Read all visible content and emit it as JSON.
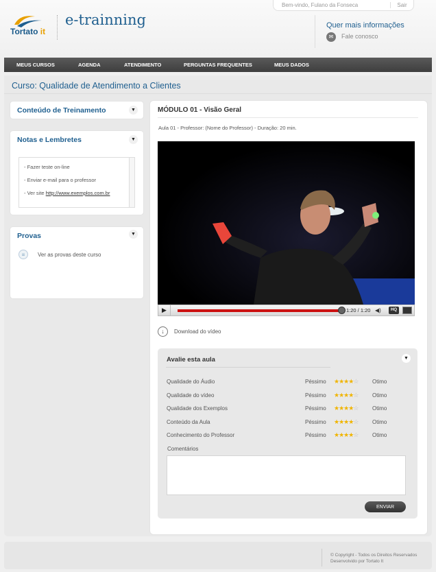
{
  "header": {
    "welcome": "Bem-vindo, Fulano da Fonseca",
    "exit": "Sair",
    "logo_text": "Tortato",
    "logo_suffix": "it",
    "brand": "e-trainning",
    "info_title": "Quer mais informações",
    "contact_label": "Fale conosco"
  },
  "nav": {
    "items": [
      "MEUS CURSOS",
      "AGENDA",
      "ATENDIMENTO",
      "PERGUNTAS FREQUENTES",
      "MEUS DADOS"
    ]
  },
  "course": {
    "title": "Curso: Qualidade de Atendimento a Clientes"
  },
  "sidebar": {
    "training_title": "Conteúdo de Treinamento",
    "notes_title": "Notas e Lembretes",
    "notes": [
      "- Fazer teste on-line",
      "- Enviar e-mail para o professor"
    ],
    "site_prefix": "- Ver site",
    "site_link": "http://www.exemplos.com.br",
    "exams_title": "Provas",
    "exams_link": "Ver as provas deste curso"
  },
  "module": {
    "title": "MÓDULO 01 - Visão Geral",
    "lesson": "Aula 01 - Professor: (Nome do Professor) - Duração: 20 min."
  },
  "player": {
    "time": "1:20 / 1:20",
    "hq": "HQ",
    "progress": 1.0
  },
  "download": {
    "label": "Download do vídeo"
  },
  "rating": {
    "title": "Avalie esta aula",
    "low_label": "Péssimo",
    "high_label": "Otimo",
    "criteria": [
      {
        "name": "Qualidade do Áudio",
        "stars": 4
      },
      {
        "name": "Qualidade do vídeo",
        "stars": 4
      },
      {
        "name": "Qualidade dos Exemplos",
        "stars": 4
      },
      {
        "name": "Conteúdo da Aula",
        "stars": 4
      },
      {
        "name": "Conhecimento do Professor",
        "stars": 4
      }
    ],
    "max_stars": 5,
    "comments_label": "Comentários",
    "send_label": "ENVIAR"
  },
  "footer": {
    "copyright": "© Copyright - Todos os Direitos Reservados",
    "developer": "Desenvolvido por Tortato It"
  },
  "colors": {
    "accent": "#1f5f8f",
    "nav": "#4a4a4a",
    "star": "#f0b400",
    "progress": "#cc1111"
  }
}
